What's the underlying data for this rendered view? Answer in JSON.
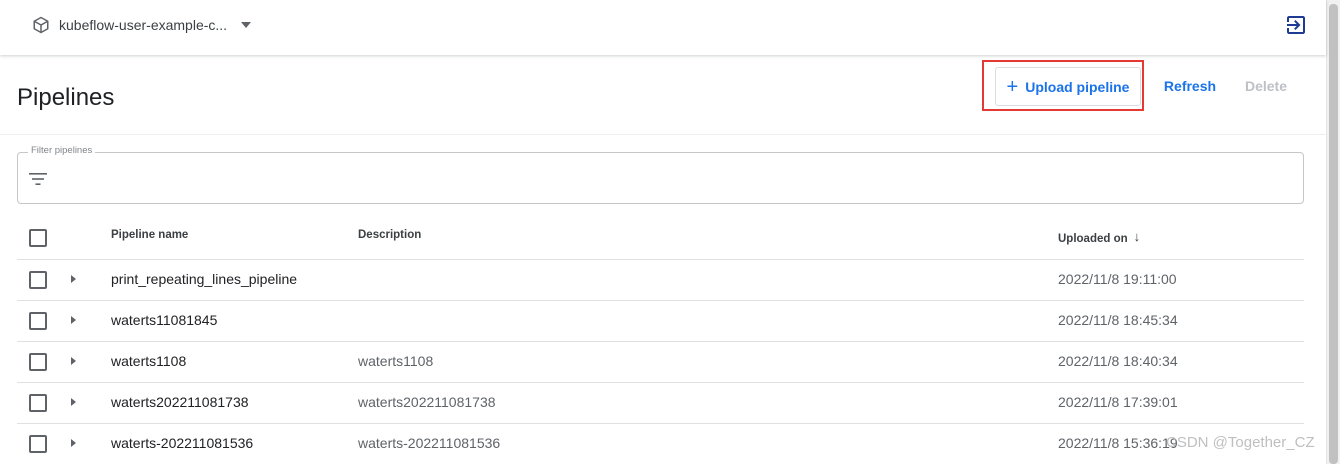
{
  "header": {
    "namespace": "kubeflow-user-example-c..."
  },
  "page": {
    "title": "Pipelines",
    "actions": {
      "upload_label": "Upload pipeline",
      "upload_plus": "+",
      "refresh_label": "Refresh",
      "delete_label": "Delete"
    }
  },
  "filter": {
    "label": "Filter pipelines",
    "value": ""
  },
  "table": {
    "columns": {
      "name": "Pipeline name",
      "description": "Description",
      "uploaded": "Uploaded on",
      "sort_arrow": "↓"
    },
    "rows": [
      {
        "name": "print_repeating_lines_pipeline",
        "description": "",
        "uploaded": "2022/11/8 19:11:00"
      },
      {
        "name": "waterts11081845",
        "description": "",
        "uploaded": "2022/11/8 18:45:34"
      },
      {
        "name": "waterts1108",
        "description": "waterts1108",
        "uploaded": "2022/11/8 18:40:34"
      },
      {
        "name": "waterts202211081738",
        "description": "waterts202211081738",
        "uploaded": "2022/11/8 17:39:01"
      },
      {
        "name": "waterts-202211081536",
        "description": "waterts-202211081536",
        "uploaded": "2022/11/8 15:36:19"
      }
    ]
  },
  "watermark": "CSDN @Together_CZ",
  "icons": {
    "namespace": "cube-icon",
    "namespace_caret": "caret-down-icon",
    "logout": "logout-icon",
    "filter": "filter-list-icon",
    "upload": "plus-icon",
    "expand": "expand-arrow-icon",
    "sort": "arrow-downward-icon"
  },
  "colors": {
    "primary": "#1a73e8",
    "disabled": "#bdc1c6",
    "highlight": "#e53935",
    "text": "#202124",
    "secondary_text": "#5f6368"
  }
}
